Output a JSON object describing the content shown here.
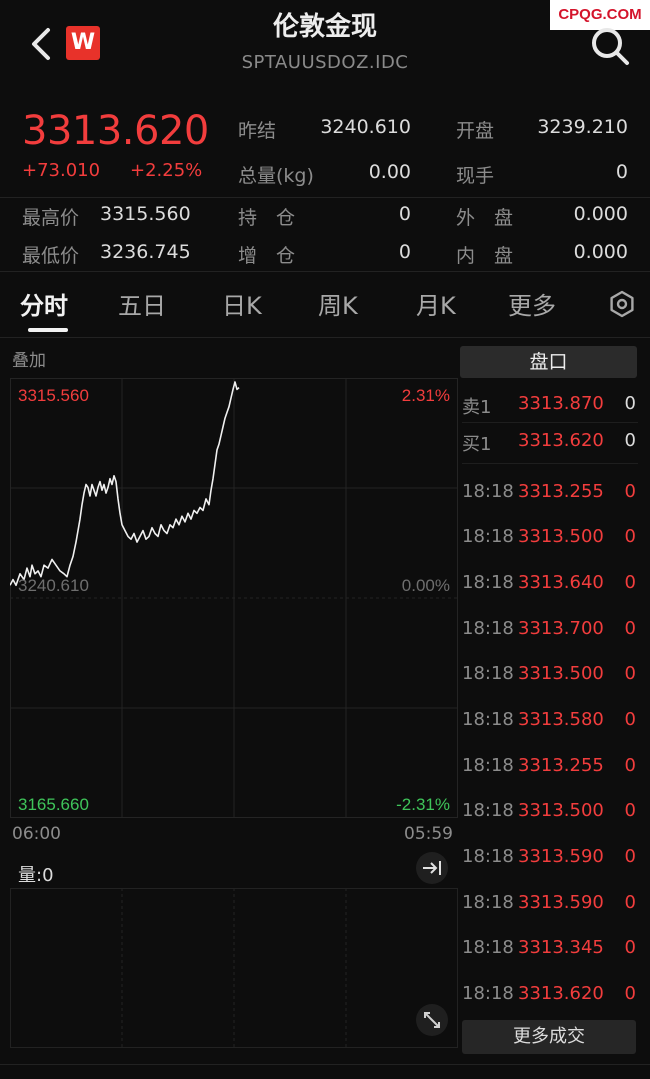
{
  "header": {
    "title": "伦敦金现",
    "code": "SPTAUUSDOZ.IDC",
    "logo_letter": "W",
    "watermark": "CPQG.COM"
  },
  "quote": {
    "price": "3313.620",
    "change": "+73.010",
    "change_pct": "+2.25%",
    "fields": {
      "prev_settle": {
        "label": "昨结",
        "value": "3240.610"
      },
      "open": {
        "label": "开盘",
        "value": "3239.210"
      },
      "volume": {
        "label": "总量(kg)",
        "value": "0.00"
      },
      "last_hand": {
        "label": "现手",
        "value": "0"
      },
      "high": {
        "label": "最高价",
        "value": "3315.560"
      },
      "open_interest": {
        "label": "持　仓",
        "value": "0"
      },
      "outer": {
        "label": "外　盘",
        "value": "0.000"
      },
      "low": {
        "label": "最低价",
        "value": "3236.745"
      },
      "oi_change": {
        "label": "增　仓",
        "value": "0"
      },
      "inner": {
        "label": "内　盘",
        "value": "0.000"
      }
    }
  },
  "tabs": [
    "分时",
    "五日",
    "日K",
    "周K",
    "月K",
    "更多"
  ],
  "active_tab": "分时",
  "chart": {
    "overlay_label": "叠加",
    "top_price": "3315.560",
    "top_pct": "2.31%",
    "mid_price": "3240.610",
    "mid_pct": "0.00%",
    "bottom_price": "3165.660",
    "bottom_pct": "-2.31%",
    "time_start": "06:00",
    "time_end": "05:59",
    "volume_label": "量:0",
    "colors": {
      "line": "#f0f0f0",
      "up": "#f23d3d",
      "down": "#3fc45a",
      "grid": "#262626"
    }
  },
  "chart_data": {
    "type": "line",
    "x": [
      0,
      3,
      6,
      10,
      14,
      17,
      20,
      22,
      25,
      28,
      31,
      34,
      38,
      42,
      46,
      50,
      54,
      57,
      60,
      63,
      66,
      68,
      70,
      72,
      74,
      76,
      78,
      80,
      82,
      84,
      86,
      88,
      90,
      92,
      94,
      96,
      98,
      100,
      102,
      104,
      106,
      108,
      110,
      112,
      115,
      118,
      121,
      124,
      127,
      130,
      133,
      136,
      139,
      142,
      145,
      148,
      151,
      154,
      157,
      160,
      163,
      166,
      169,
      172,
      175,
      178,
      181,
      184,
      187,
      190,
      193,
      196,
      199,
      201,
      203,
      205,
      207,
      209,
      211,
      213,
      215,
      217,
      219,
      221,
      223,
      225,
      227,
      229
    ],
    "y": [
      3245,
      3247,
      3245,
      3249,
      3247,
      3251,
      3248,
      3252,
      3249,
      3250,
      3248,
      3252,
      3251,
      3254,
      3252,
      3250,
      3249,
      3248,
      3252,
      3255,
      3260,
      3264,
      3268,
      3273,
      3277,
      3280,
      3279,
      3276,
      3280,
      3278,
      3276,
      3279,
      3281,
      3278,
      3280,
      3277,
      3279,
      3282,
      3280,
      3283,
      3281,
      3275,
      3270,
      3266,
      3264,
      3262,
      3261,
      3263,
      3260,
      3262,
      3264,
      3261,
      3262,
      3265,
      3263,
      3262,
      3266,
      3264,
      3263,
      3266,
      3265,
      3268,
      3266,
      3269,
      3267,
      3270,
      3268,
      3271,
      3270,
      3272,
      3271,
      3275,
      3273,
      3278,
      3282,
      3287,
      3292,
      3294,
      3297,
      3300,
      3303,
      3305,
      3307,
      3310,
      3313,
      3315.56,
      3313,
      3313.62
    ],
    "ylim": [
      3165.66,
      3315.56
    ],
    "xlim": [
      0,
      448
    ],
    "baseline": 3240.61,
    "title": "",
    "xlabel": "",
    "ylabel": ""
  },
  "book": {
    "header": "盘口",
    "quotes": [
      {
        "label": "卖1",
        "price": "3313.870",
        "qty": "0"
      },
      {
        "label": "买1",
        "price": "3313.620",
        "qty": "0"
      }
    ],
    "trades": [
      {
        "time": "18:18",
        "price": "3313.255",
        "qty": "0"
      },
      {
        "time": "18:18",
        "price": "3313.500",
        "qty": "0"
      },
      {
        "time": "18:18",
        "price": "3313.640",
        "qty": "0"
      },
      {
        "time": "18:18",
        "price": "3313.700",
        "qty": "0"
      },
      {
        "time": "18:18",
        "price": "3313.500",
        "qty": "0"
      },
      {
        "time": "18:18",
        "price": "3313.580",
        "qty": "0"
      },
      {
        "time": "18:18",
        "price": "3313.255",
        "qty": "0"
      },
      {
        "time": "18:18",
        "price": "3313.500",
        "qty": "0"
      },
      {
        "time": "18:18",
        "price": "3313.590",
        "qty": "0"
      },
      {
        "time": "18:18",
        "price": "3313.590",
        "qty": "0"
      },
      {
        "time": "18:18",
        "price": "3313.345",
        "qty": "0"
      },
      {
        "time": "18:18",
        "price": "3313.620",
        "qty": "0"
      }
    ],
    "more_label": "更多成交"
  },
  "icons": {
    "back": "chevron-left-icon",
    "search": "search-icon",
    "settings": "settings-hexagon-icon",
    "jump_end": "jump-to-end-icon",
    "expand": "expand-diagonal-icon"
  }
}
